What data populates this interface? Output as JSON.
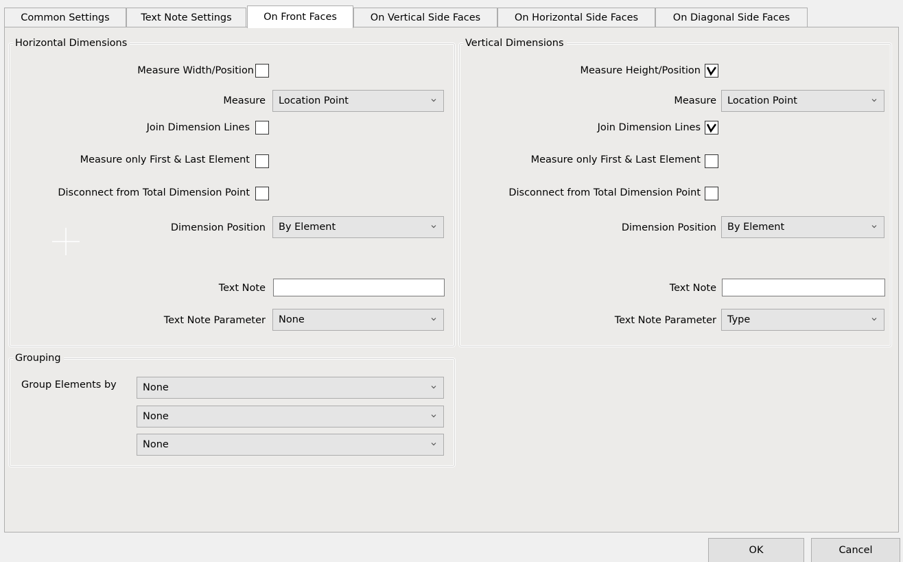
{
  "tabs": [
    {
      "label": "Common Settings"
    },
    {
      "label": "Text Note Settings"
    },
    {
      "label": "On Front Faces"
    },
    {
      "label": "On Vertical Side Faces"
    },
    {
      "label": "On Horizontal Side Faces"
    },
    {
      "label": "On Diagonal Side Faces"
    }
  ],
  "active_tab": "On Front Faces",
  "horizontal": {
    "title": "Horizontal Dimensions",
    "measure_width_label": "Measure Width/Position",
    "measure_width_checked": false,
    "measure_label": "Measure",
    "measure_value": "Location Point",
    "join_label": "Join Dimension Lines",
    "join_checked": false,
    "first_last_label": "Measure only First & Last Element",
    "first_last_checked": false,
    "disconnect_label": "Disconnect from Total Dimension Point",
    "disconnect_checked": false,
    "position_label": "Dimension Position",
    "position_value": "By Element",
    "text_note_label": "Text Note",
    "text_note_value": "",
    "text_note_param_label": "Text Note Parameter",
    "text_note_param_value": "None"
  },
  "vertical": {
    "title": "Vertical Dimensions",
    "measure_height_label": "Measure Height/Position",
    "measure_height_checked": true,
    "measure_label": "Measure",
    "measure_value": "Location Point",
    "join_label": "Join Dimension Lines",
    "join_checked": true,
    "first_last_label": "Measure only First & Last Element",
    "first_last_checked": false,
    "disconnect_label": "Disconnect from Total Dimension Point",
    "disconnect_checked": false,
    "position_label": "Dimension Position",
    "position_value": "By Element",
    "text_note_label": "Text Note",
    "text_note_value": "",
    "text_note_param_label": "Text Note Parameter",
    "text_note_param_value": "Type"
  },
  "grouping": {
    "title": "Grouping",
    "group_by_label": "Group Elements by",
    "selects": [
      {
        "value": "None"
      },
      {
        "value": "None"
      },
      {
        "value": "None"
      }
    ]
  },
  "buttons": {
    "ok_label": "OK",
    "cancel_label": "Cancel"
  },
  "icons": {
    "checkmark": "checkmark-icon",
    "dropdown": "chevron-down-icon"
  }
}
